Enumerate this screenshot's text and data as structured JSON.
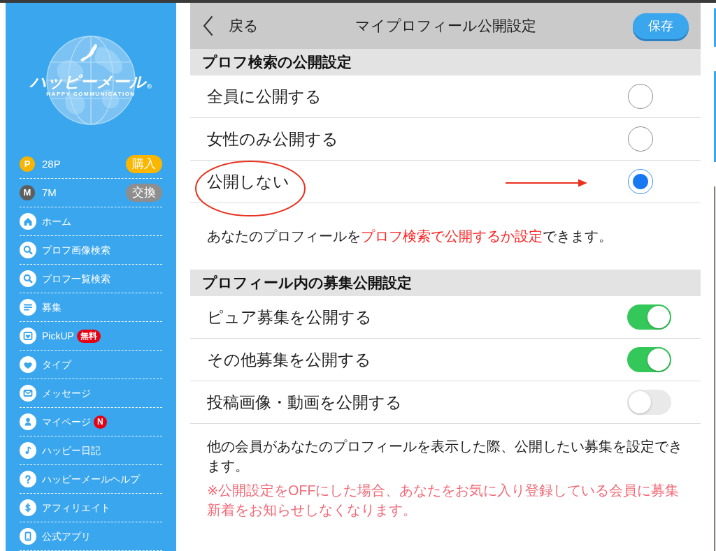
{
  "sidebar": {
    "logo": {
      "title": "ハッピーメール",
      "registered_mark": "®",
      "tagline": "HAPPY COMMUNICATION"
    },
    "balances": [
      {
        "kind": "points",
        "icon_letter": "P",
        "color": "#f8b400",
        "amount": "28P",
        "action": "購入"
      },
      {
        "kind": "miles",
        "icon_letter": "M",
        "color": "#5e5e5e",
        "amount": "7M",
        "action": "交換"
      }
    ],
    "items": [
      {
        "kind": "home",
        "label": "ホーム"
      },
      {
        "kind": "search",
        "label": "プロフ画像検索"
      },
      {
        "kind": "search",
        "label": "プロフ一覧検索"
      },
      {
        "kind": "recruit",
        "label": "募集"
      },
      {
        "kind": "pickup",
        "label": "PickUP",
        "badge": "無料"
      },
      {
        "kind": "type",
        "label": "タイプ"
      },
      {
        "kind": "message",
        "label": "メッセージ"
      },
      {
        "kind": "mypage",
        "label": "マイページ",
        "badge": "N"
      },
      {
        "kind": "diary",
        "label": "ハッピー日記"
      },
      {
        "kind": "help",
        "label": "ハッピーメールヘルプ"
      },
      {
        "kind": "affiliate",
        "label": "アフィリエイト"
      },
      {
        "kind": "app",
        "label": "公式アプリ"
      }
    ]
  },
  "header": {
    "back_label": "戻る",
    "title": "マイプロフィール公開設定",
    "save_button": "保存"
  },
  "sections": [
    {
      "title": "プロフ検索の公開設定",
      "options": [
        {
          "kind": "radio",
          "label": "全員に公開する",
          "selected": false
        },
        {
          "kind": "radio",
          "label": "女性のみ公開する",
          "selected": false
        },
        {
          "kind": "radio",
          "label": "公開しない",
          "selected": true
        }
      ],
      "notes": [
        {
          "kind": "info",
          "parts": [
            {
              "text": "あなたのプロフィールを",
              "highlight": false
            },
            {
              "text": "プロフ検索で公開するか設定",
              "highlight": true
            },
            {
              "text": "できます。",
              "highlight": false
            }
          ]
        }
      ]
    },
    {
      "title": "プロフィール内の募集公開設定",
      "options": [
        {
          "kind": "toggle",
          "label": "ピュア募集を公開する",
          "on": true
        },
        {
          "kind": "toggle",
          "label": "その他募集を公開する",
          "on": true
        },
        {
          "kind": "toggle",
          "label": "投稿画像・動画を公開する",
          "on": false
        }
      ],
      "notes": [
        {
          "kind": "info",
          "parts": [
            {
              "text": "他の会員があなたのプロフィールを表示した際、公開したい募集を設定できます。",
              "highlight": false
            }
          ]
        },
        {
          "kind": "warning",
          "parts": [
            {
              "text": "※公開設定をOFFにした場合、あなたをお気に入り登録している会員に募集新着をお知らせしなくなります。",
              "highlight": false
            }
          ]
        }
      ]
    }
  ]
}
